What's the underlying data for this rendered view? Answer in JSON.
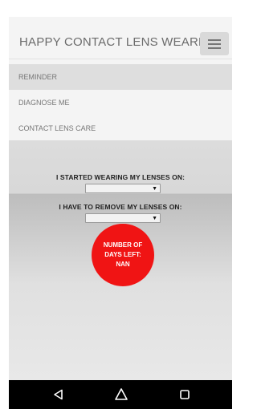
{
  "header": {
    "title": "HAPPY CONTACT LENS WEARER",
    "menu_icon": "hamburger-menu-icon"
  },
  "nav": {
    "items": [
      {
        "label": "REMINDER",
        "active": true
      },
      {
        "label": "DIAGNOSE ME",
        "active": false
      },
      {
        "label": "CONTACT LENS CARE",
        "active": false
      }
    ]
  },
  "form": {
    "start_label": "I STARTED WEARING MY LENSES ON:",
    "start_value": "",
    "remove_label": "I HAVE TO REMOVE MY LENSES ON:",
    "remove_value": ""
  },
  "counter": {
    "text": "NUMBER OF DAYS LEFT: NAN",
    "color": "#f01414"
  },
  "system_nav": {
    "back_icon": "back-triangle-icon",
    "home_icon": "home-circle-icon",
    "recents_icon": "recents-square-icon"
  }
}
